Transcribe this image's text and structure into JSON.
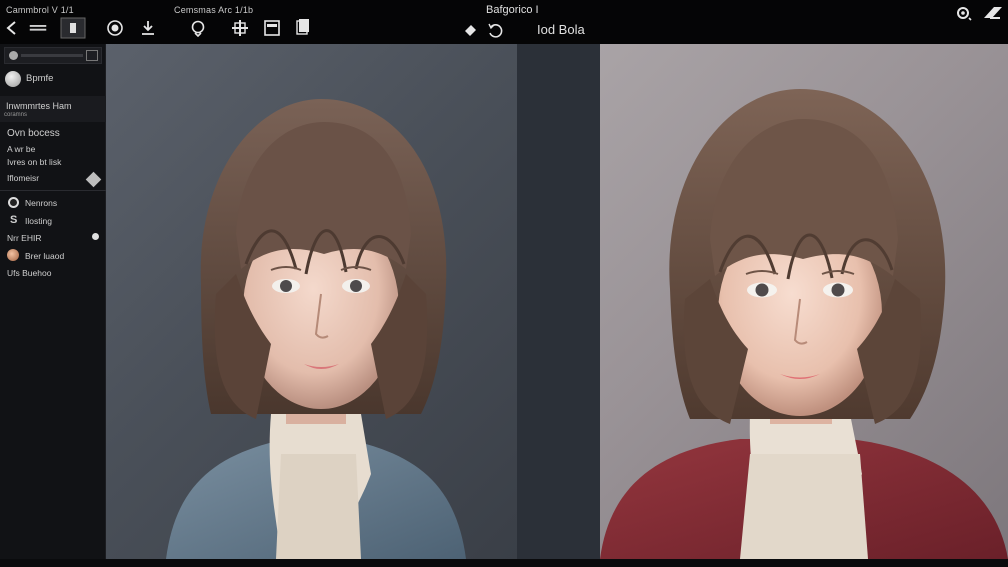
{
  "toolbar": {
    "app_label": "Cammbrol V 1/1",
    "sub_label": "Cemsmas Arc 1/1b",
    "title": "Bafgorico I",
    "compare_label": "Iod Bola",
    "icons": [
      "back-icon",
      "menu-icon",
      "layer-icon",
      "circle-icon",
      "download-icon",
      "brush-icon",
      "move-icon",
      "panel-icon",
      "copy-icon",
      "eraser-icon",
      "undo-icon",
      "settings-icon",
      "logo-icon"
    ]
  },
  "sidebar": {
    "profile_label": "Bpmfe",
    "section_header": "Inwmmrtes Ham",
    "section_sub": "coramns",
    "items": [
      {
        "label": "Ovn bocess"
      },
      {
        "label": "A wr be"
      },
      {
        "label": "Ivres on bt lisk"
      },
      {
        "label": "Iflomeisr"
      },
      {
        "label": "Nenrons"
      },
      {
        "label": "Ilosting"
      },
      {
        "label": "Nrr EHIR"
      },
      {
        "label": "Brer luaod"
      },
      {
        "label": "Ufs Buehoo"
      }
    ]
  },
  "canvas": {
    "left_image": "portrait-before",
    "right_image": "portrait-after"
  },
  "colors": {
    "toolbar_bg": "#050506",
    "sidebar_bg": "#111215",
    "canvas_bg": "#2a2f36",
    "left_backdrop": "#4f555e",
    "right_backdrop": "#9d969a",
    "sweater_left": "#5d7385",
    "sweater_right": "#7c2a32",
    "hair": "#5a4336"
  }
}
